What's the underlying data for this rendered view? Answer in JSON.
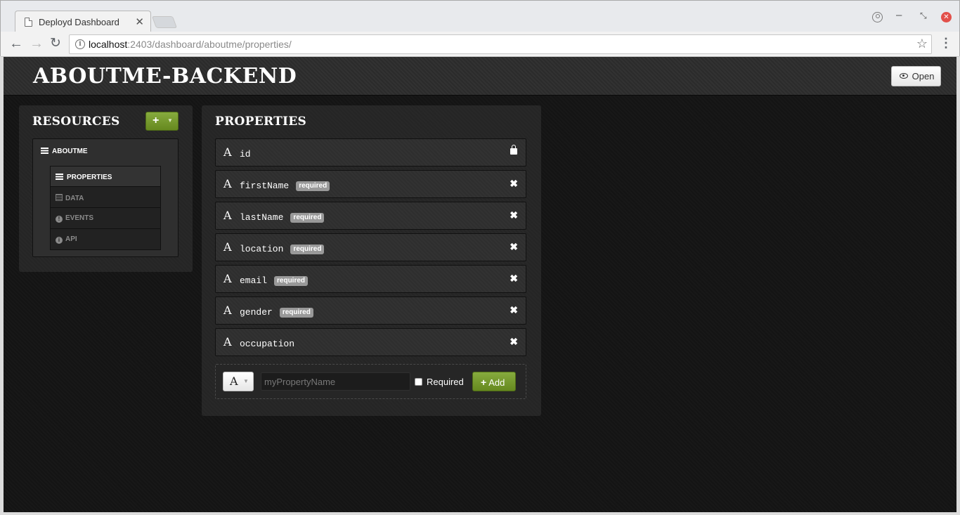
{
  "browser": {
    "tab_title": "Deployd Dashboard",
    "url_host": "localhost",
    "url_rest": ":2403/dashboard/aboutme/properties/"
  },
  "app": {
    "title": "ABOUTME-BACKEND",
    "open_label": "Open"
  },
  "resources": {
    "heading": "RESOURCES",
    "add_button": "+",
    "resource_name": "ABOUTME",
    "subnav": [
      {
        "label": "PROPERTIES",
        "icon": "list-icon",
        "active": true
      },
      {
        "label": "DATA",
        "icon": "grid-icon",
        "active": false
      },
      {
        "label": "EVENTS",
        "icon": "exclamation-icon",
        "active": false
      },
      {
        "label": "API",
        "icon": "info-icon",
        "active": false
      }
    ]
  },
  "properties": {
    "heading": "PROPERTIES",
    "type_glyph": "A",
    "items": [
      {
        "name": "id",
        "badge": "",
        "action": "lock-icon"
      },
      {
        "name": "firstName",
        "badge": "required",
        "action": "delete-icon"
      },
      {
        "name": "lastName",
        "badge": "required",
        "action": "delete-icon"
      },
      {
        "name": "location",
        "badge": "required",
        "action": "delete-icon"
      },
      {
        "name": "email",
        "badge": "required",
        "action": "delete-icon"
      },
      {
        "name": "gender",
        "badge": "required",
        "action": "delete-icon"
      },
      {
        "name": "occupation",
        "badge": "",
        "action": "delete-icon"
      }
    ],
    "form": {
      "type_value": "A",
      "name_placeholder": "myPropertyName",
      "required_label": "Required",
      "add_label": "Add"
    }
  },
  "colors": {
    "accent_green": "#77a02c",
    "badge_gray": "#999999",
    "background": "#141414"
  }
}
